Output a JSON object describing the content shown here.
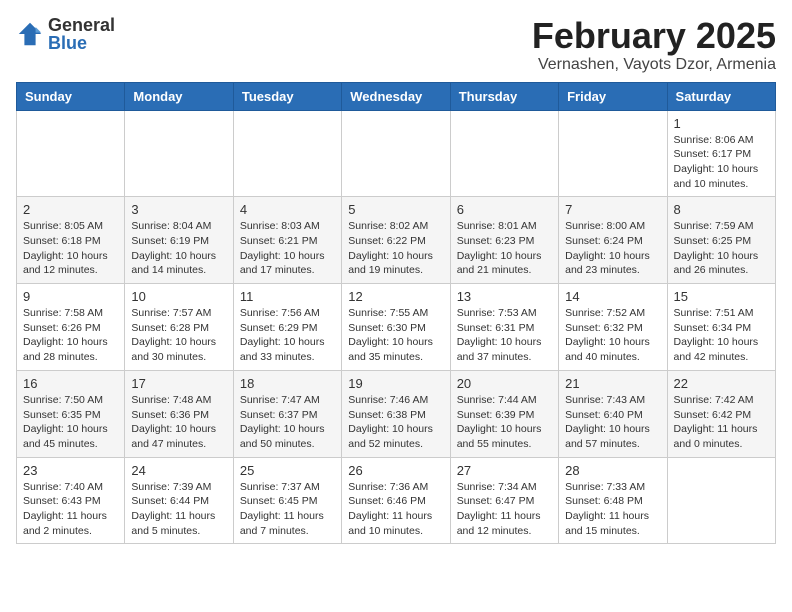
{
  "header": {
    "logo_general": "General",
    "logo_blue": "Blue",
    "month_year": "February 2025",
    "location": "Vernashen, Vayots Dzor, Armenia"
  },
  "weekdays": [
    "Sunday",
    "Monday",
    "Tuesday",
    "Wednesday",
    "Thursday",
    "Friday",
    "Saturday"
  ],
  "weeks": [
    [
      {
        "day": "",
        "info": ""
      },
      {
        "day": "",
        "info": ""
      },
      {
        "day": "",
        "info": ""
      },
      {
        "day": "",
        "info": ""
      },
      {
        "day": "",
        "info": ""
      },
      {
        "day": "",
        "info": ""
      },
      {
        "day": "1",
        "info": "Sunrise: 8:06 AM\nSunset: 6:17 PM\nDaylight: 10 hours and 10 minutes."
      }
    ],
    [
      {
        "day": "2",
        "info": "Sunrise: 8:05 AM\nSunset: 6:18 PM\nDaylight: 10 hours and 12 minutes."
      },
      {
        "day": "3",
        "info": "Sunrise: 8:04 AM\nSunset: 6:19 PM\nDaylight: 10 hours and 14 minutes."
      },
      {
        "day": "4",
        "info": "Sunrise: 8:03 AM\nSunset: 6:21 PM\nDaylight: 10 hours and 17 minutes."
      },
      {
        "day": "5",
        "info": "Sunrise: 8:02 AM\nSunset: 6:22 PM\nDaylight: 10 hours and 19 minutes."
      },
      {
        "day": "6",
        "info": "Sunrise: 8:01 AM\nSunset: 6:23 PM\nDaylight: 10 hours and 21 minutes."
      },
      {
        "day": "7",
        "info": "Sunrise: 8:00 AM\nSunset: 6:24 PM\nDaylight: 10 hours and 23 minutes."
      },
      {
        "day": "8",
        "info": "Sunrise: 7:59 AM\nSunset: 6:25 PM\nDaylight: 10 hours and 26 minutes."
      }
    ],
    [
      {
        "day": "9",
        "info": "Sunrise: 7:58 AM\nSunset: 6:26 PM\nDaylight: 10 hours and 28 minutes."
      },
      {
        "day": "10",
        "info": "Sunrise: 7:57 AM\nSunset: 6:28 PM\nDaylight: 10 hours and 30 minutes."
      },
      {
        "day": "11",
        "info": "Sunrise: 7:56 AM\nSunset: 6:29 PM\nDaylight: 10 hours and 33 minutes."
      },
      {
        "day": "12",
        "info": "Sunrise: 7:55 AM\nSunset: 6:30 PM\nDaylight: 10 hours and 35 minutes."
      },
      {
        "day": "13",
        "info": "Sunrise: 7:53 AM\nSunset: 6:31 PM\nDaylight: 10 hours and 37 minutes."
      },
      {
        "day": "14",
        "info": "Sunrise: 7:52 AM\nSunset: 6:32 PM\nDaylight: 10 hours and 40 minutes."
      },
      {
        "day": "15",
        "info": "Sunrise: 7:51 AM\nSunset: 6:34 PM\nDaylight: 10 hours and 42 minutes."
      }
    ],
    [
      {
        "day": "16",
        "info": "Sunrise: 7:50 AM\nSunset: 6:35 PM\nDaylight: 10 hours and 45 minutes."
      },
      {
        "day": "17",
        "info": "Sunrise: 7:48 AM\nSunset: 6:36 PM\nDaylight: 10 hours and 47 minutes."
      },
      {
        "day": "18",
        "info": "Sunrise: 7:47 AM\nSunset: 6:37 PM\nDaylight: 10 hours and 50 minutes."
      },
      {
        "day": "19",
        "info": "Sunrise: 7:46 AM\nSunset: 6:38 PM\nDaylight: 10 hours and 52 minutes."
      },
      {
        "day": "20",
        "info": "Sunrise: 7:44 AM\nSunset: 6:39 PM\nDaylight: 10 hours and 55 minutes."
      },
      {
        "day": "21",
        "info": "Sunrise: 7:43 AM\nSunset: 6:40 PM\nDaylight: 10 hours and 57 minutes."
      },
      {
        "day": "22",
        "info": "Sunrise: 7:42 AM\nSunset: 6:42 PM\nDaylight: 11 hours and 0 minutes."
      }
    ],
    [
      {
        "day": "23",
        "info": "Sunrise: 7:40 AM\nSunset: 6:43 PM\nDaylight: 11 hours and 2 minutes."
      },
      {
        "day": "24",
        "info": "Sunrise: 7:39 AM\nSunset: 6:44 PM\nDaylight: 11 hours and 5 minutes."
      },
      {
        "day": "25",
        "info": "Sunrise: 7:37 AM\nSunset: 6:45 PM\nDaylight: 11 hours and 7 minutes."
      },
      {
        "day": "26",
        "info": "Sunrise: 7:36 AM\nSunset: 6:46 PM\nDaylight: 11 hours and 10 minutes."
      },
      {
        "day": "27",
        "info": "Sunrise: 7:34 AM\nSunset: 6:47 PM\nDaylight: 11 hours and 12 minutes."
      },
      {
        "day": "28",
        "info": "Sunrise: 7:33 AM\nSunset: 6:48 PM\nDaylight: 11 hours and 15 minutes."
      },
      {
        "day": "",
        "info": ""
      }
    ]
  ]
}
